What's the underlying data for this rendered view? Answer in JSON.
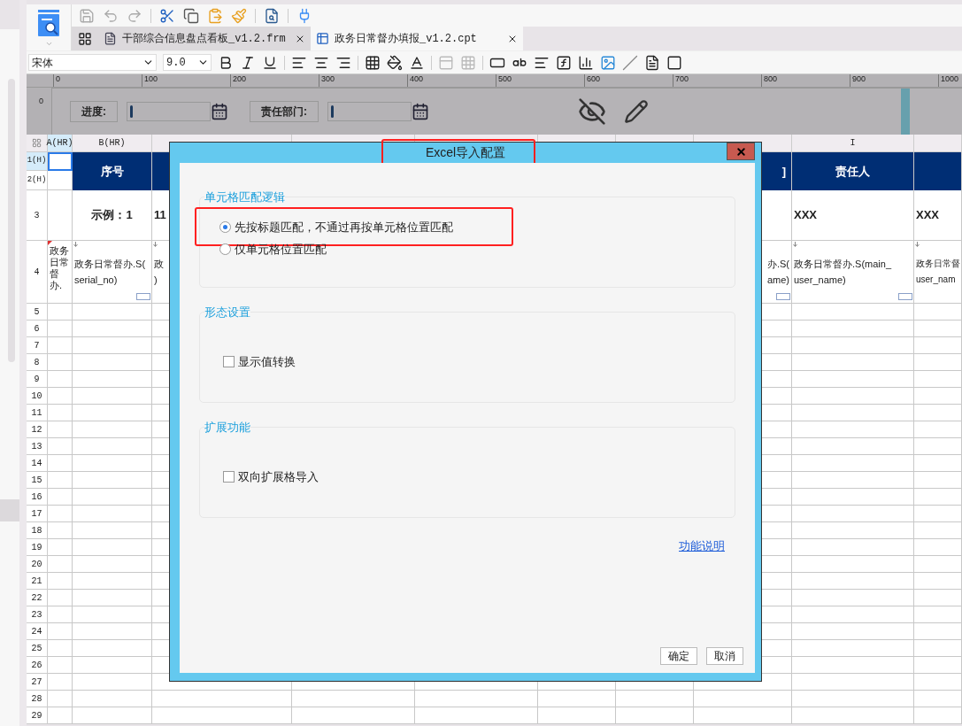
{
  "toolbar": {
    "font": "宋体",
    "size": "9.0"
  },
  "tabs": [
    {
      "label": "干部综合信息盘点看板_v1.2.frm",
      "kind": "form",
      "selected": false
    },
    {
      "label": "政务日常督办填报_v1.2.cpt",
      "kind": "report",
      "selected": true
    }
  ],
  "ruler": {
    "ticks": [
      "0",
      "100",
      "200",
      "300",
      "400",
      "500",
      "600",
      "700",
      "800",
      "900",
      "1000"
    ],
    "side_tick": "0"
  },
  "parameters": [
    {
      "label": "进度:"
    },
    {
      "label": "责任部门:"
    }
  ],
  "sheet": {
    "columns": [
      {
        "label": "A(HR)",
        "selected": true
      },
      {
        "label": "B(HR)",
        "selected": false
      },
      {
        "selected": false
      },
      {
        "selected": false
      },
      {
        "selected": false
      },
      {
        "selected": false
      },
      {
        "selected": false
      },
      {
        "selected": false
      },
      {
        "label": "I",
        "selected": false
      },
      {
        "selected": false
      }
    ],
    "rows": [
      {
        "label": "1(H)",
        "selected": true
      },
      {
        "label": "2(H)",
        "selected": false
      },
      {
        "label": "3",
        "selected": false
      },
      {
        "label": "4",
        "selected": false
      },
      {
        "label": "5",
        "selected": false
      },
      {
        "label": "6",
        "selected": false
      },
      {
        "label": "7",
        "selected": false
      },
      {
        "label": "8",
        "selected": false
      },
      {
        "label": "9",
        "selected": false
      },
      {
        "label": "10",
        "selected": false
      },
      {
        "label": "11",
        "selected": false
      },
      {
        "label": "12",
        "selected": false
      },
      {
        "label": "13",
        "selected": false
      },
      {
        "label": "14",
        "selected": false
      },
      {
        "label": "15",
        "selected": false
      },
      {
        "label": "16",
        "selected": false
      },
      {
        "label": "17",
        "selected": false
      },
      {
        "label": "18",
        "selected": false
      },
      {
        "label": "19",
        "selected": false
      },
      {
        "label": "20",
        "selected": false
      },
      {
        "label": "21",
        "selected": false
      },
      {
        "label": "22",
        "selected": false
      },
      {
        "label": "23",
        "selected": false
      },
      {
        "label": "24",
        "selected": false
      },
      {
        "label": "25",
        "selected": false
      },
      {
        "label": "26",
        "selected": false
      },
      {
        "label": "27",
        "selected": false
      },
      {
        "label": "28",
        "selected": false
      },
      {
        "label": "29",
        "selected": false
      }
    ],
    "anchor_cell": {
      "selected": true
    },
    "title_band": [
      {
        "kind": "text",
        "text": "序号"
      },
      {
        "kind": "blank"
      },
      {
        "kind": "blank"
      },
      {
        "kind": "blank"
      },
      {
        "kind": "blank"
      },
      {
        "kind": "blank"
      },
      {
        "kind": "text",
        "text": "]"
      },
      {
        "kind": "text",
        "text": "责任人"
      },
      {
        "kind": "blank"
      }
    ],
    "row_3": [
      {
        "kind": "blank"
      },
      {
        "kind": "text",
        "text": "示例：1"
      },
      {
        "kind": "text",
        "text": "11"
      },
      {
        "kind": "blank"
      },
      {
        "kind": "blank"
      },
      {
        "kind": "blank"
      },
      {
        "kind": "blank"
      },
      {
        "kind": "blank"
      },
      {
        "kind": "text",
        "text": "XXX"
      },
      {
        "kind": "text",
        "text": "XXX"
      }
    ],
    "row_4": [
      {
        "kind": "text",
        "text": "政务日常督办."
      },
      {
        "kind": "text",
        "text": "政务日常督办.S(\nserial_no)"
      },
      {
        "kind": "text",
        "text": "政\n)"
      },
      {
        "kind": "blank"
      },
      {
        "kind": "blank"
      },
      {
        "kind": "blank"
      },
      {
        "kind": "blank"
      },
      {
        "kind": "text",
        "text": "办.S(\name)"
      },
      {
        "kind": "text",
        "text": "政务日常督办.S(main_\nuser_name)"
      },
      {
        "kind": "text",
        "text": "政务日常督\nuser_nam"
      }
    ]
  },
  "dialog": {
    "title": "Excel导入配置",
    "title_highlighted": true,
    "groups": [
      {
        "kind": "radio",
        "title": "单元格匹配逻辑",
        "options": [
          {
            "label": "先按标题匹配，不通过再按单元格位置匹配",
            "selected": true,
            "highlighted": true
          },
          {
            "label": "仅单元格位置匹配",
            "selected": false,
            "highlighted": false
          }
        ]
      },
      {
        "kind": "check",
        "title": "形态设置",
        "options": [
          {
            "label": "显示值转换",
            "checked": false
          }
        ]
      },
      {
        "kind": "check",
        "title": "扩展功能",
        "options": [
          {
            "label": "双向扩展格导入",
            "checked": false
          }
        ]
      }
    ],
    "help_link": "功能说明",
    "buttons": [
      "确定",
      "取消"
    ]
  }
}
